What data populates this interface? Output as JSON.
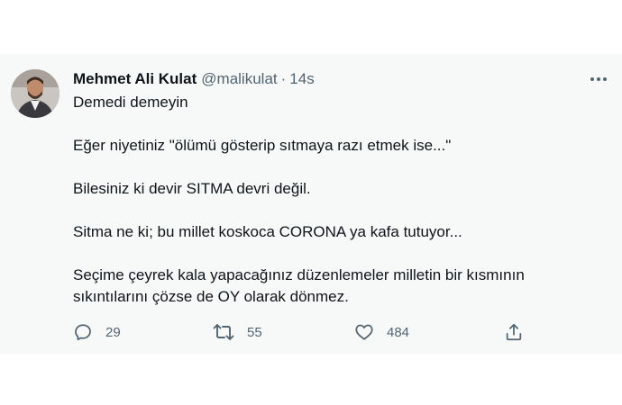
{
  "tweet": {
    "author": {
      "display_name": "Mehmet Ali Kulat",
      "handle": "@malikulat",
      "separator": "·",
      "time": "14s"
    },
    "text": [
      "Demedi demeyin",
      "Eğer niyetiniz \"ölümü gösterip sıtmaya razı etmek ise...\"",
      "Bilesiniz ki devir SITMA devri değil.",
      "Sitma ne ki; bu millet koskoca CORONA ya kafa tutuyor...",
      "Seçime çeyrek kala yapacağınız düzenlemeler milletin bir kısmının sıkıntılarını çözse de OY olarak dönmez."
    ],
    "actions": {
      "reply": {
        "icon": "reply-icon",
        "count": "29"
      },
      "retweet": {
        "icon": "retweet-icon",
        "count": "55"
      },
      "like": {
        "icon": "heart-icon",
        "count": "484"
      },
      "share": {
        "icon": "share-icon"
      }
    }
  },
  "colors": {
    "card_background": "#f7f9f9",
    "text_primary": "#0f1419",
    "text_secondary": "#536471"
  }
}
